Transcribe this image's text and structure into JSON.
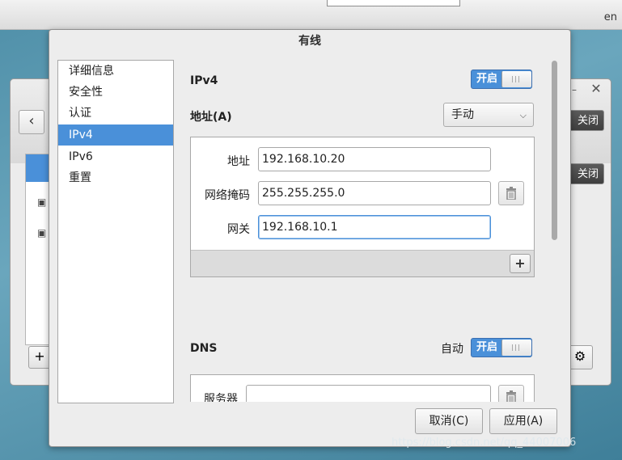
{
  "system": {
    "language": "en"
  },
  "background_window": {
    "close_label": "关闭",
    "close_label_2": "关闭",
    "back_icon": "chevron-left-icon",
    "add_icon": "plus-icon",
    "settings_icon": "gear-icon"
  },
  "dialog": {
    "title": "有线",
    "sidebar": {
      "items": [
        {
          "label": "详细信息"
        },
        {
          "label": "安全性"
        },
        {
          "label": "认证"
        },
        {
          "label": "IPv4"
        },
        {
          "label": "IPv6"
        },
        {
          "label": "重置"
        }
      ],
      "selected": "IPv4"
    },
    "ipv4": {
      "section_label": "IPv4",
      "toggle_on": "开启",
      "address_label": "地址(A)",
      "method": "手动",
      "address_field_label": "地址",
      "address_value": "192.168.10.20",
      "netmask_label": "网络掩码",
      "netmask_value": "255.255.255.0",
      "gateway_label": "网关",
      "gateway_value": "192.168.10.1"
    },
    "dns": {
      "section_label": "DNS",
      "auto_label": "自动",
      "toggle_on": "开启",
      "server_label": "服务器",
      "server_value": ""
    },
    "buttons": {
      "cancel": "取消(C)",
      "apply": "应用(A)"
    }
  },
  "watermark": "https://blog.csdn.net/qq_44007006"
}
